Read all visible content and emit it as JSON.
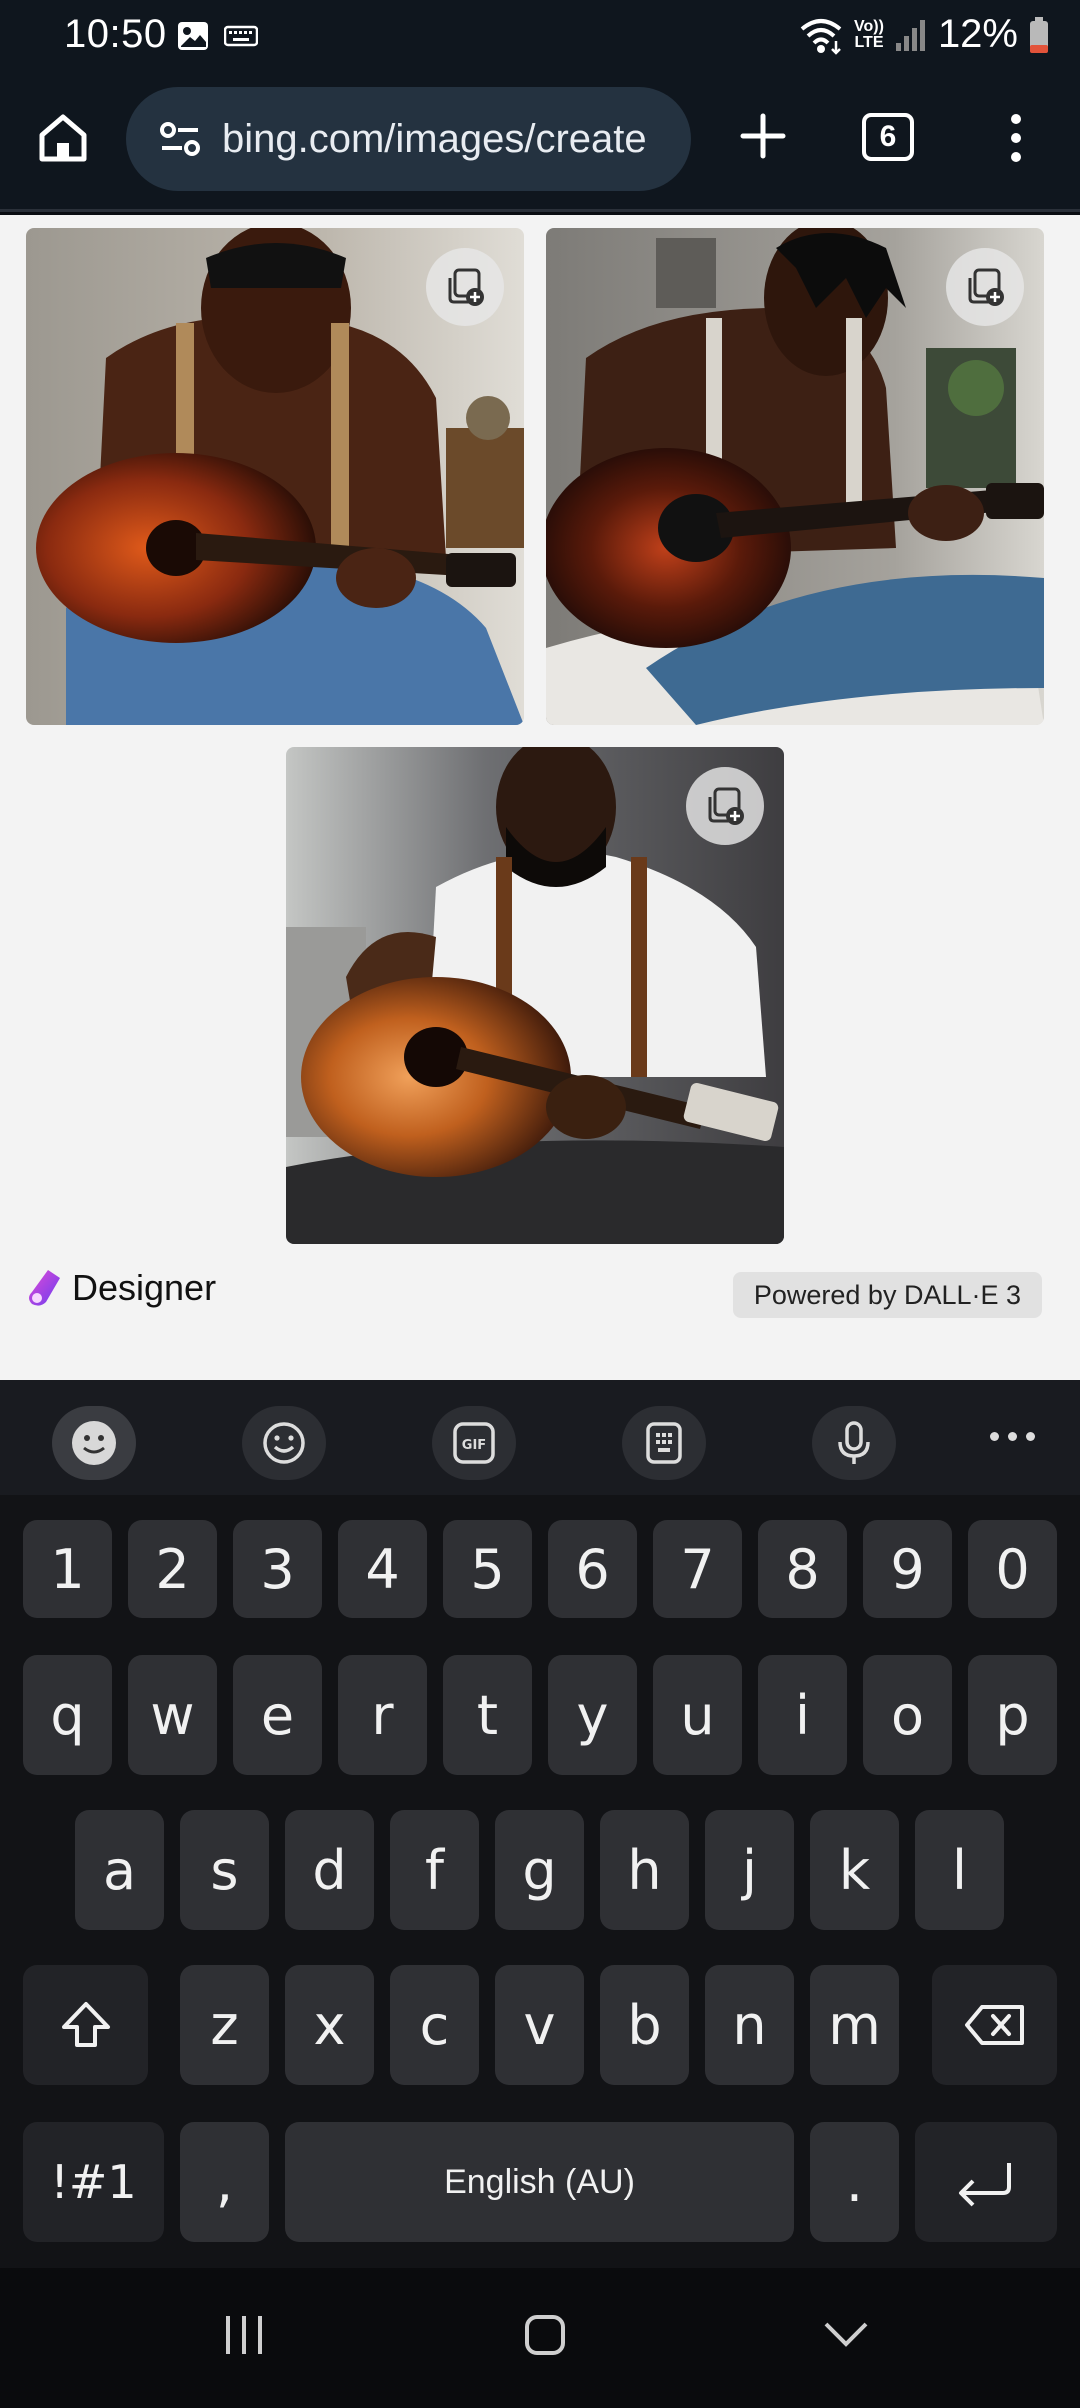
{
  "status_bar": {
    "time": "10:50",
    "volte_line1": "Vo))",
    "volte_line2": "LTE",
    "battery": "12%"
  },
  "browser": {
    "url": "bing.com/images/create",
    "tab_count": "6"
  },
  "content": {
    "designer_label": "Designer",
    "powered_by": "Powered by DALL·E 3"
  },
  "keyboard": {
    "number_row": [
      "1",
      "2",
      "3",
      "4",
      "5",
      "6",
      "7",
      "8",
      "9",
      "0"
    ],
    "row1": [
      "q",
      "w",
      "e",
      "r",
      "t",
      "y",
      "u",
      "i",
      "o",
      "p"
    ],
    "row2": [
      "a",
      "s",
      "d",
      "f",
      "g",
      "h",
      "j",
      "k",
      "l"
    ],
    "row3": [
      "z",
      "x",
      "c",
      "v",
      "b",
      "n",
      "m"
    ],
    "symbols_key": "!#1",
    "comma_key": ",",
    "space_label": "English (AU)",
    "period_key": "."
  },
  "icons": {
    "toolbar": [
      "expression-icon",
      "emoji-icon",
      "gif-icon",
      "clipboard-icon",
      "mic-icon",
      "more-icon"
    ],
    "nav": [
      "recent-apps-icon",
      "home-icon",
      "hide-keyboard-icon"
    ]
  }
}
